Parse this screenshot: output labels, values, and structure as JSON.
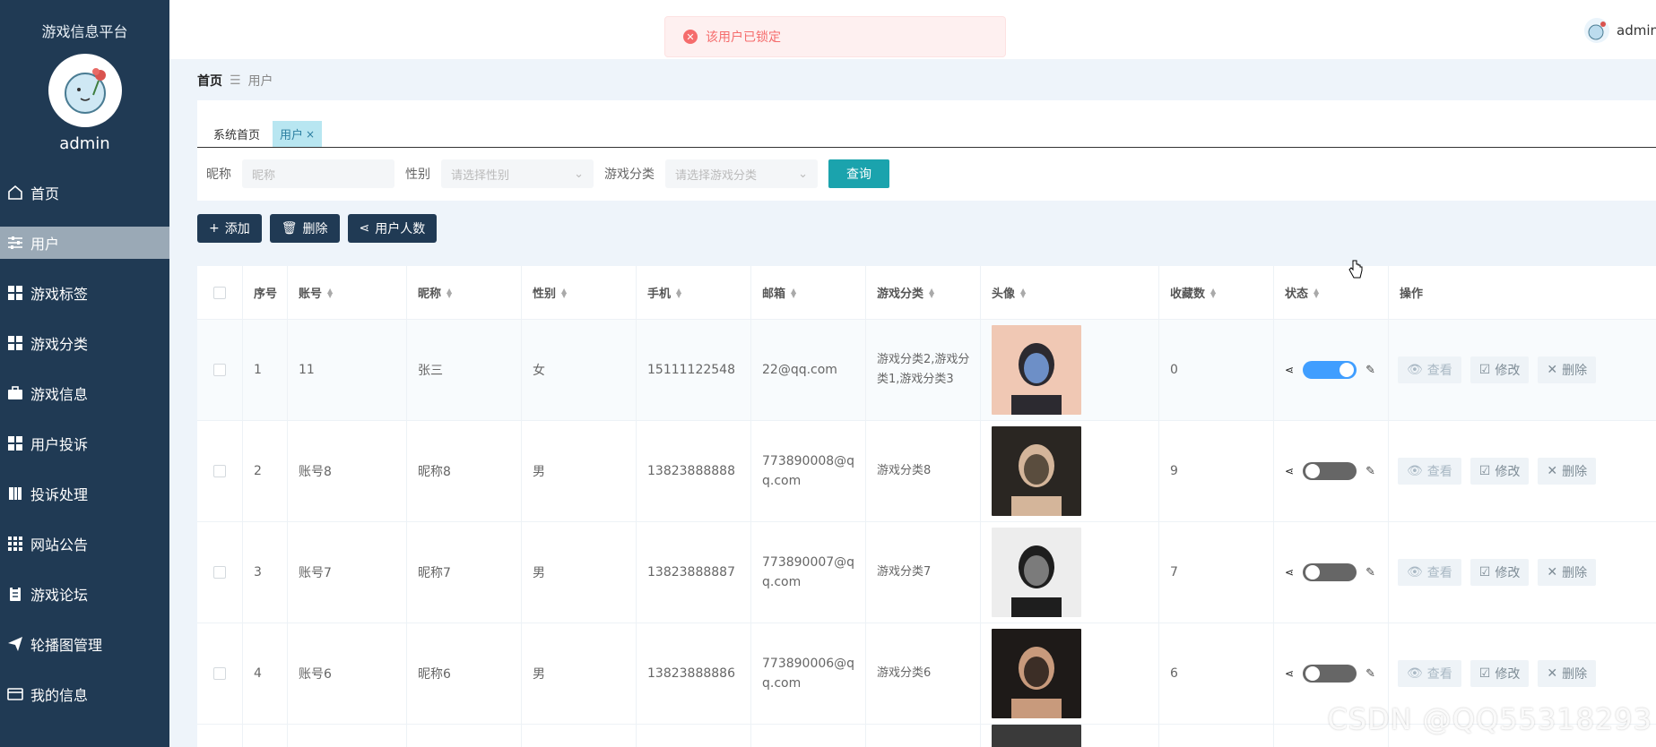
{
  "sidebar": {
    "platform_title": "游戏信息平台",
    "username": "admin",
    "items": [
      {
        "label": "首页",
        "icon": "home-icon"
      },
      {
        "label": "用户",
        "icon": "sliders-icon"
      },
      {
        "label": "游戏标签",
        "icon": "grid-icon"
      },
      {
        "label": "游戏分类",
        "icon": "grid-icon"
      },
      {
        "label": "游戏信息",
        "icon": "briefcase-icon"
      },
      {
        "label": "用户投诉",
        "icon": "grid-icon"
      },
      {
        "label": "投诉处理",
        "icon": "book-icon"
      },
      {
        "label": "网站公告",
        "icon": "apps-icon"
      },
      {
        "label": "游戏论坛",
        "icon": "clipboard-icon"
      },
      {
        "label": "轮播图管理",
        "icon": "send-icon"
      },
      {
        "label": "我的信息",
        "icon": "card-icon"
      }
    ],
    "active_index": 1
  },
  "header": {
    "toast_message": "该用户已锁定",
    "user_label": "admin"
  },
  "breadcrumb": {
    "home": "首页",
    "separator": "☰",
    "current": "用户"
  },
  "tabs": [
    {
      "label": "系统首页"
    },
    {
      "label": "用户",
      "close": "×"
    }
  ],
  "search": {
    "nickname_label": "昵称",
    "nickname_placeholder": "昵称",
    "gender_label": "性别",
    "gender_placeholder": "请选择性别",
    "category_label": "游戏分类",
    "category_placeholder": "请选择游戏分类",
    "query_button": "查询"
  },
  "actions": {
    "add": "添加",
    "delete": "删除",
    "count": "用户人数"
  },
  "table": {
    "headers": [
      "序号",
      "账号",
      "昵称",
      "性别",
      "手机",
      "邮箱",
      "游戏分类",
      "头像",
      "收藏数",
      "状态",
      "操作"
    ],
    "rows": [
      {
        "index": "1",
        "account": "11",
        "nickname": "张三",
        "gender": "女",
        "phone": "15111122548",
        "email": "22@qq.com",
        "category": "游戏分类2,游戏分类1,游戏分类3",
        "favorites": "0",
        "status_on": true
      },
      {
        "index": "2",
        "account": "账号8",
        "nickname": "昵称8",
        "gender": "男",
        "phone": "13823888888",
        "email": "773890008@qq.com",
        "category": "游戏分类8",
        "favorites": "9",
        "status_on": false
      },
      {
        "index": "3",
        "account": "账号7",
        "nickname": "昵称7",
        "gender": "男",
        "phone": "13823888887",
        "email": "773890007@qq.com",
        "category": "游戏分类7",
        "favorites": "7",
        "status_on": false
      },
      {
        "index": "4",
        "account": "账号6",
        "nickname": "昵称6",
        "gender": "男",
        "phone": "13823888886",
        "email": "773890006@qq.com",
        "category": "游戏分类6",
        "favorites": "6",
        "status_on": false
      }
    ],
    "op_view": "查看",
    "op_edit": "修改",
    "op_delete": "删除"
  },
  "watermark": "CSDN @QQ55318293",
  "colors": {
    "sidebar_bg": "#203a54",
    "accent": "#1ba3ad",
    "switch_on": "#409eff",
    "toast_text": "#f56c6c"
  }
}
